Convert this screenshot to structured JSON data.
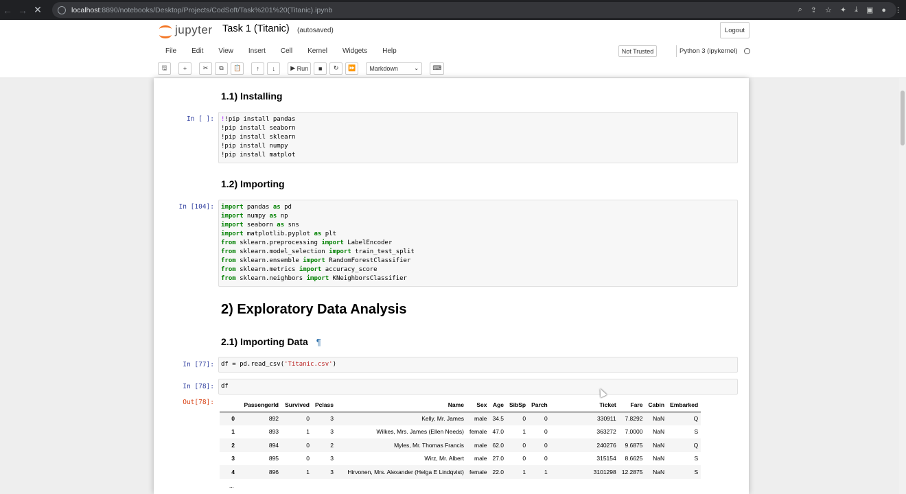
{
  "browser": {
    "url_host": "localhost",
    "url_path": ":8890/notebooks/Desktop/Projects/CodSoft/Task%201%20(Titanic).ipynb"
  },
  "header": {
    "logo_text": "jupyter",
    "notebook_title": "Task 1 (Titanic)",
    "autosave_status": "(autosaved)",
    "logout_label": "Logout"
  },
  "menu": [
    "File",
    "Edit",
    "View",
    "Insert",
    "Cell",
    "Kernel",
    "Widgets",
    "Help"
  ],
  "trust_status": "Not Trusted",
  "kernel_name": "Python 3 (ipykernel)",
  "toolbar": {
    "run_label": "Run",
    "cell_type": "Markdown"
  },
  "notebook": {
    "h_installing": "1.1) Installing",
    "cell1_prompt": "In [ ]:",
    "cell1_lines": [
      "!pip install pandas",
      "!pip install seaborn",
      "!pip install sklearn",
      "!pip install numpy",
      "!pip install matplot"
    ],
    "h_importing": "1.2) Importing",
    "cell2_prompt": "In [104]:",
    "h_eda": "2) Exploratory Data Analysis",
    "h_importing_data": "2.1) Importing Data",
    "pilcrow": "¶",
    "cell3_prompt": "In [77]:",
    "cell3_prefix": "df = pd.read_csv(",
    "cell3_string": "'Titanic.csv'",
    "cell3_suffix": ")",
    "cell4_prompt": "In [78]:",
    "cell4_code": "df",
    "out_prompt": "Out[78]:"
  },
  "imports": [
    {
      "kw1": "import",
      "mod": " pandas ",
      "kw2": "as",
      "rest": " pd"
    },
    {
      "kw1": "import",
      "mod": " numpy ",
      "kw2": "as",
      "rest": " np"
    },
    {
      "kw1": "import",
      "mod": " seaborn ",
      "kw2": "as",
      "rest": " sns"
    },
    {
      "kw1": "import",
      "mod": " matplotlib.pyplot ",
      "kw2": "as",
      "rest": " plt"
    },
    {
      "kw1": "from",
      "mod": " sklearn.preprocessing ",
      "kw2": "import",
      "rest": " LabelEncoder"
    },
    {
      "kw1": "from",
      "mod": " sklearn.model_selection ",
      "kw2": "import",
      "rest": " train_test_split"
    },
    {
      "kw1": "from",
      "mod": " sklearn.ensemble ",
      "kw2": "import",
      "rest": " RandomForestClassifier"
    },
    {
      "kw1": "from",
      "mod": " sklearn.metrics ",
      "kw2": "import",
      "rest": " accuracy_score"
    },
    {
      "kw1": "from",
      "mod": " sklearn.neighbors ",
      "kw2": "import",
      "rest": " KNeighborsClassifier"
    }
  ],
  "dataframe": {
    "columns": [
      "",
      "PassengerId",
      "Survived",
      "Pclass",
      "Name",
      "Sex",
      "Age",
      "SibSp",
      "Parch",
      "Ticket",
      "Fare",
      "Cabin",
      "Embarked"
    ],
    "rows": [
      [
        "0",
        "892",
        "0",
        "3",
        "Kelly, Mr. James",
        "male",
        "34.5",
        "0",
        "0",
        "330911",
        "7.8292",
        "NaN",
        "Q"
      ],
      [
        "1",
        "893",
        "1",
        "3",
        "Wilkes, Mrs. James (Ellen Needs)",
        "female",
        "47.0",
        "1",
        "0",
        "363272",
        "7.0000",
        "NaN",
        "S"
      ],
      [
        "2",
        "894",
        "0",
        "2",
        "Myles, Mr. Thomas Francis",
        "male",
        "62.0",
        "0",
        "0",
        "240276",
        "9.6875",
        "NaN",
        "Q"
      ],
      [
        "3",
        "895",
        "0",
        "3",
        "Wirz, Mr. Albert",
        "male",
        "27.0",
        "0",
        "0",
        "315154",
        "8.6625",
        "NaN",
        "S"
      ],
      [
        "4",
        "896",
        "1",
        "3",
        "Hirvonen, Mrs. Alexander (Helga E Lindqvist)",
        "female",
        "22.0",
        "1",
        "1",
        "3101298",
        "12.2875",
        "NaN",
        "S"
      ]
    ],
    "ellipsis": "..."
  }
}
